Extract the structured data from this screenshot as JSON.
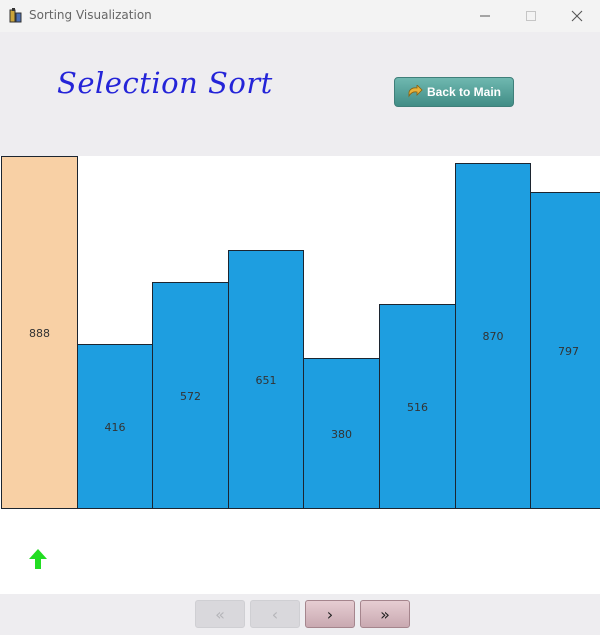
{
  "window": {
    "title": "Sorting Visualization"
  },
  "header": {
    "title": "Selection Sort",
    "back_button_label": "Back to Main"
  },
  "colors": {
    "highlight_bar": "#f8d0a5",
    "normal_bar": "#1e9ee0",
    "title_color": "#2424d8",
    "pointer_arrow": "#22dd22"
  },
  "chart_data": {
    "type": "bar",
    "values": [
      888,
      416,
      572,
      651,
      380,
      516,
      870,
      797
    ],
    "highlighted_index": 0,
    "ylim": [
      0,
      888
    ]
  },
  "bars": [
    {
      "label": "888"
    },
    {
      "label": "416"
    },
    {
      "label": "572"
    },
    {
      "label": "651"
    },
    {
      "label": "380"
    },
    {
      "label": "516"
    },
    {
      "label": "870"
    },
    {
      "label": "797"
    }
  ],
  "navigation": {
    "first_label": "«",
    "prev_label": "‹",
    "next_label": "›",
    "last_label": "»",
    "first_enabled": false,
    "prev_enabled": false,
    "next_enabled": true,
    "last_enabled": true
  },
  "icons": {
    "app": "app-icon",
    "pointer": "arrow-up-icon",
    "back": "back-arrow-icon"
  }
}
